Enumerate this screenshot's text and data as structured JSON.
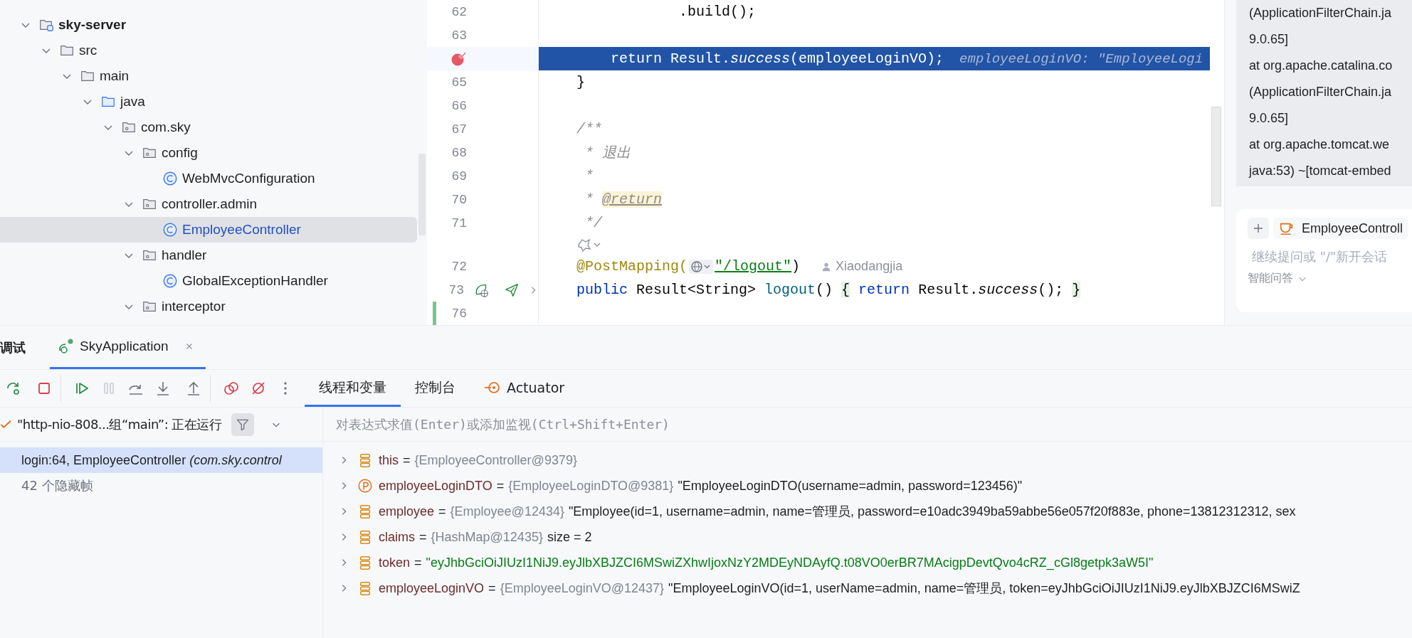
{
  "project_tree": {
    "items": [
      {
        "name": "sky-server",
        "kind": "module",
        "expanded": true,
        "selected": false,
        "children": [
          {
            "name": "src",
            "kind": "folder",
            "expanded": true,
            "selected": false,
            "children": [
              {
                "name": "main",
                "kind": "folder",
                "expanded": true,
                "selected": false,
                "children": [
                  {
                    "name": "java",
                    "kind": "source-root",
                    "expanded": true,
                    "selected": false,
                    "children": [
                      {
                        "name": "com.sky",
                        "kind": "package",
                        "expanded": true,
                        "selected": false,
                        "children": [
                          {
                            "name": "config",
                            "kind": "package",
                            "expanded": true,
                            "selected": false,
                            "children": [
                              {
                                "name": "WebMvcConfiguration",
                                "kind": "class",
                                "selected": false
                              }
                            ]
                          },
                          {
                            "name": "controller.admin",
                            "kind": "package",
                            "expanded": true,
                            "selected": false,
                            "children": [
                              {
                                "name": "EmployeeController",
                                "kind": "class",
                                "selected": true
                              }
                            ]
                          },
                          {
                            "name": "handler",
                            "kind": "package",
                            "expanded": true,
                            "selected": false,
                            "children": [
                              {
                                "name": "GlobalExceptionHandler",
                                "kind": "class",
                                "selected": false
                              }
                            ]
                          },
                          {
                            "name": "interceptor",
                            "kind": "package",
                            "expanded": true,
                            "selected": false
                          }
                        ]
                      }
                    ]
                  }
                ]
              }
            ]
          }
        ]
      }
    ]
  },
  "editor": {
    "lines": [
      {
        "kind": "code",
        "number": "62",
        "current": false,
        "segments": [
          {
            "text": "                .build();",
            "kind": "plain"
          }
        ]
      },
      {
        "kind": "code",
        "number": "63",
        "current": false
      },
      {
        "kind": "code",
        "current": true,
        "markers": [
          {
            "kind": "breakpoint"
          }
        ],
        "segments": [
          {
            "text": "        return",
            "kind": "keyword"
          },
          {
            "text": " Result.",
            "kind": "plain"
          },
          {
            "text": "success",
            "kind": "static"
          },
          {
            "text": "(employeeLoginVO);",
            "kind": "plain"
          }
        ],
        "hint": "employeeLoginVO: \"EmployeeLogi"
      },
      {
        "kind": "code",
        "number": "65",
        "current": false,
        "segments": [
          {
            "text": "    }",
            "kind": "plain"
          }
        ]
      },
      {
        "kind": "code",
        "number": "66",
        "current": false
      },
      {
        "kind": "code",
        "number": "67",
        "current": false,
        "segments": [
          {
            "text": "    /**",
            "kind": "comment"
          }
        ]
      },
      {
        "kind": "code",
        "number": "68",
        "current": false,
        "segments": [
          {
            "text": "     * 退出",
            "kind": "comment"
          }
        ]
      },
      {
        "kind": "code",
        "number": "69",
        "current": false,
        "segments": [
          {
            "text": "     *",
            "kind": "comment"
          }
        ]
      },
      {
        "kind": "code",
        "number": "70",
        "current": false,
        "segments": [
          {
            "text": "     * ",
            "kind": "comment"
          },
          {
            "text": "@return",
            "kind": "doctag"
          }
        ]
      },
      {
        "kind": "code",
        "number": "71",
        "current": false,
        "segments": [
          {
            "text": "     */",
            "kind": "comment"
          }
        ]
      },
      {
        "kind": "inlay"
      },
      {
        "kind": "code",
        "number": "72",
        "current": false,
        "segments": [
          {
            "text": "    @PostMapping(",
            "kind": "annotation"
          },
          {
            "kind": "url-icon"
          },
          {
            "text": "\"/logout\"",
            "kind": "link-string"
          },
          {
            "text": ")",
            "kind": "plain"
          }
        ],
        "author": "Xiaodangjia"
      },
      {
        "kind": "code",
        "number": "73",
        "current": false,
        "markers": [
          {
            "kind": "endpoint"
          },
          {
            "kind": "request"
          },
          {
            "kind": "expand"
          }
        ],
        "segments": [
          {
            "text": "    public",
            "kind": "keyword"
          },
          {
            "text": " Result<String> ",
            "kind": "plain"
          },
          {
            "text": "logout",
            "kind": "declaration"
          },
          {
            "text": "() ",
            "kind": "plain"
          },
          {
            "text": "{",
            "kind": "fold"
          },
          {
            "text": " return",
            "kind": "keyword"
          },
          {
            "text": " Result.",
            "kind": "plain"
          },
          {
            "text": "success",
            "kind": "static"
          },
          {
            "text": "(); ",
            "kind": "plain"
          },
          {
            "text": "}",
            "kind": "fold"
          }
        ]
      },
      {
        "kind": "code",
        "number": "76",
        "current": false,
        "markers": [
          {
            "kind": "added"
          }
        ]
      }
    ]
  },
  "console_panel": {
    "lines": [
      "(ApplicationFilterChain.ja",
      "9.0.65]",
      "at org.apache.catalina.co",
      "(ApplicationFilterChain.ja",
      "9.0.65]",
      "at org.apache.tomcat.we",
      "java:53) ~[tomcat-embed"
    ]
  },
  "assistant": {
    "context_chip": "EmployeeControll",
    "placeholder": "继续提问或 \"/\"新开会话",
    "mode": "智能问答"
  },
  "debug_panel": {
    "title": "调试",
    "tabs": [
      {
        "label": "SkyApplication",
        "selected": true
      }
    ],
    "toolbar": [
      {
        "kind": "rerun",
        "disabled": false
      },
      {
        "kind": "stop",
        "disabled": false
      },
      {
        "kind": "resume",
        "disabled": false
      },
      {
        "kind": "pause",
        "disabled": true
      },
      {
        "kind": "step-over",
        "disabled": false
      },
      {
        "kind": "step-into",
        "disabled": false
      },
      {
        "kind": "step-out",
        "disabled": false
      },
      {
        "kind": "view-breakpoints",
        "disabled": false
      },
      {
        "kind": "mute-breakpoints",
        "disabled": false
      },
      {
        "kind": "more",
        "disabled": false
      }
    ],
    "views": [
      {
        "label": "线程和变量",
        "kind": "plain",
        "selected": true
      },
      {
        "label": "控制台",
        "kind": "plain",
        "selected": false
      },
      {
        "label": "Actuator",
        "kind": "actuator",
        "selected": false
      }
    ],
    "thread": "\"http-nio-808...组“main”: 正在运行",
    "frames": [
      {
        "text": "login:64, EmployeeController *(com.sky.control*",
        "selected": true
      }
    ],
    "hidden_frames": "42 个隐藏帧",
    "evaluate_placeholder": "对表达式求值(Enter)或添加监视(Ctrl+Shift+Enter)",
    "variables": [
      {
        "name": "this",
        "kind": "field",
        "operator": "=",
        "ref": "{EmployeeController@9379}"
      },
      {
        "name": "employeeLoginDTO",
        "kind": "parameter",
        "operator": "=",
        "ref": "{EmployeeLoginDTO@9381}",
        "value": "\"EmployeeLoginDTO(username=admin, password=123456)\"",
        "string": false
      },
      {
        "name": "employee",
        "kind": "field",
        "operator": "=",
        "ref": "{Employee@12434}",
        "value": "\"Employee(id=1, username=admin, name=管理员, password=e10adc3949ba59abbe56e057f20f883e, phone=13812312312, sex",
        "string": false
      },
      {
        "name": "claims",
        "kind": "field",
        "operator": "=",
        "ref": "{HashMap@12435}",
        "value": "size = 2",
        "string": false
      },
      {
        "name": "token",
        "kind": "field",
        "operator": "=",
        "value": "\"eyJhbGciOiJIUzI1NiJ9.eyJlbXBJZCI6MSwiZXhwIjoxNzY2MDEyNDAyfQ.t08VO0erBR7MAcigpDevtQvo4cRZ_cGl8getpk3aW5I\"",
        "string": true
      },
      {
        "name": "employeeLoginVO",
        "kind": "field",
        "operator": "=",
        "ref": "{EmployeeLoginVO@12437}",
        "value": "\"EmployeeLoginVO(id=1, userName=admin, name=管理员, token=eyJhbGciOiJIUzI1NiJ9.eyJlbXBJZCI6MSwiZ",
        "string": false
      }
    ]
  }
}
